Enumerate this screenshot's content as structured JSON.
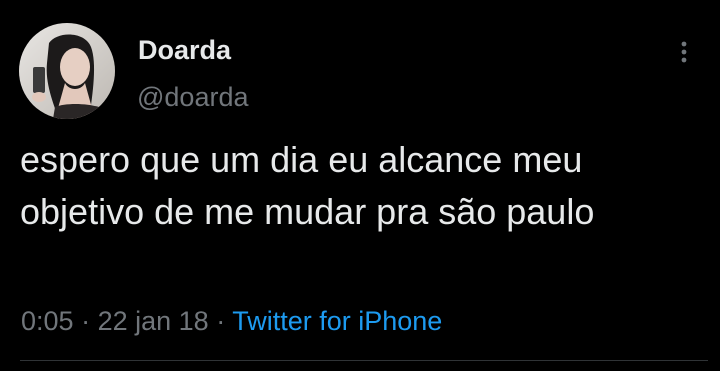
{
  "author": {
    "display_name": "Doarda",
    "handle": "@doarda",
    "avatar_icon": "profile-photo"
  },
  "menu": {
    "more_icon": "vertical-ellipsis-icon"
  },
  "tweet": {
    "text": "espero que um dia eu alcance meu objetivo de me mudar pra são paulo"
  },
  "meta": {
    "time": "0:05",
    "separator": "·",
    "date": "22 jan 18",
    "source": "Twitter for iPhone"
  },
  "colors": {
    "background": "#000000",
    "primary_text": "#e7e9ea",
    "secondary_text": "#71767b",
    "link": "#1d9bf0"
  }
}
